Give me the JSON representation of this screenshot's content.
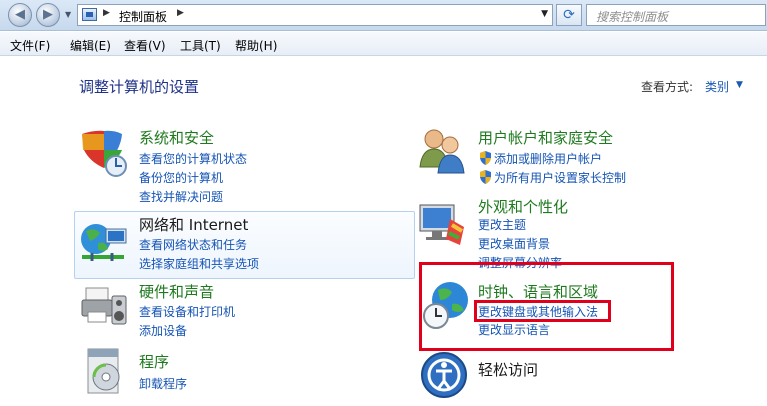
{
  "address_bar": {
    "crumb": "控制面板",
    "search_placeholder": "搜索控制面板"
  },
  "menu": [
    "文件(F)",
    "编辑(E)",
    "查看(V)",
    "工具(T)",
    "帮助(H)"
  ],
  "page": {
    "title": "调整计算机的设置",
    "view_by_label": "查看方式:",
    "view_by_value": "类别"
  },
  "categories": [
    {
      "title": "系统和安全",
      "icon": "shield-icon",
      "links": [
        "查看您的计算机状态",
        "备份您的计算机",
        "查找并解决问题"
      ]
    },
    {
      "title": "网络和 Internet",
      "icon": "network-icon",
      "links": [
        "查看网络状态和任务",
        "选择家庭组和共享选项"
      ]
    },
    {
      "title": "硬件和声音",
      "icon": "printer-icon",
      "links": [
        "查看设备和打印机",
        "添加设备"
      ]
    },
    {
      "title": "程序",
      "icon": "programs-icon",
      "links": [
        "卸载程序"
      ]
    },
    {
      "title": "用户帐户和家庭安全",
      "icon": "users-icon",
      "links": [
        "添加或删除用户帐户",
        "为所有用户设置家长控制"
      ]
    },
    {
      "title": "外观和个性化",
      "icon": "monitor-icon",
      "links": [
        "更改主题",
        "更改桌面背景",
        "调整屏幕分辨率"
      ]
    },
    {
      "title": "时钟、语言和区域",
      "icon": "clock-globe-icon",
      "links": [
        "更改键盘或其他输入法",
        "更改显示语言"
      ]
    },
    {
      "title": "轻松访问",
      "icon": "accessibility-icon",
      "links": []
    }
  ],
  "colors": {
    "category_title": "#1f7a1f",
    "link": "#1554b5",
    "highlight_red": "#e0001b"
  }
}
